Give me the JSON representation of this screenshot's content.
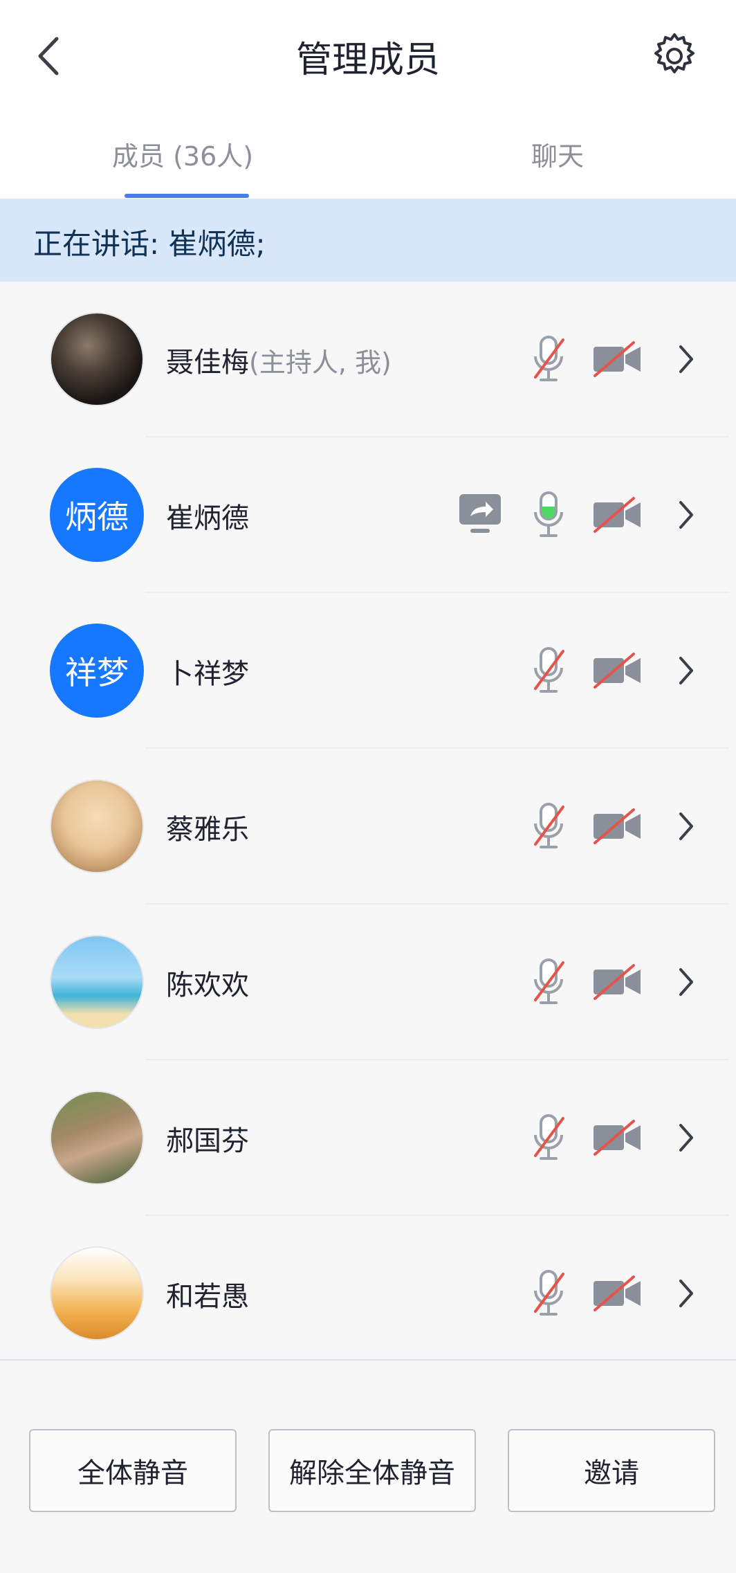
{
  "header": {
    "title": "管理成员",
    "back_icon": "chevron-left-icon",
    "settings_icon": "gear-icon"
  },
  "tabs": [
    {
      "label": "成员 (36人)",
      "active": true
    },
    {
      "label": "聊天",
      "active": false
    }
  ],
  "speaking": {
    "text": "正在讲话: 崔炳德;"
  },
  "members": [
    {
      "name": "聂佳梅",
      "role": "(主持人, 我)",
      "avatar": {
        "type": "photo",
        "theme": "dark-stage"
      },
      "sharing": false,
      "mic": "muted",
      "camera": "off"
    },
    {
      "name": "崔炳德",
      "role": "",
      "avatar": {
        "type": "letters",
        "text": "炳德",
        "color": "#1677ff"
      },
      "sharing": true,
      "mic": "active",
      "camera": "off"
    },
    {
      "name": "卜祥梦",
      "role": "",
      "avatar": {
        "type": "letters",
        "text": "祥梦",
        "color": "#1677ff"
      },
      "sharing": false,
      "mic": "muted",
      "camera": "off"
    },
    {
      "name": "蔡雅乐",
      "role": "",
      "avatar": {
        "type": "photo",
        "theme": "cartoon-boy"
      },
      "sharing": false,
      "mic": "muted",
      "camera": "off"
    },
    {
      "name": "陈欢欢",
      "role": "",
      "avatar": {
        "type": "photo",
        "theme": "beach"
      },
      "sharing": false,
      "mic": "muted",
      "camera": "off"
    },
    {
      "name": "郝国芬",
      "role": "",
      "avatar": {
        "type": "photo",
        "theme": "garden"
      },
      "sharing": false,
      "mic": "muted",
      "camera": "off"
    },
    {
      "name": "和若愚",
      "role": "",
      "avatar": {
        "type": "photo",
        "theme": "sunset-hand"
      },
      "sharing": false,
      "mic": "muted",
      "camera": "off"
    }
  ],
  "footer": {
    "mute_all_label": "全体静音",
    "unmute_all_label": "解除全体静音",
    "invite_label": "邀请"
  },
  "colors": {
    "accent": "#1677ff",
    "banner": "#d9e7fb",
    "mic_active": "#4cd964",
    "muted_slash": "#e5534b"
  }
}
